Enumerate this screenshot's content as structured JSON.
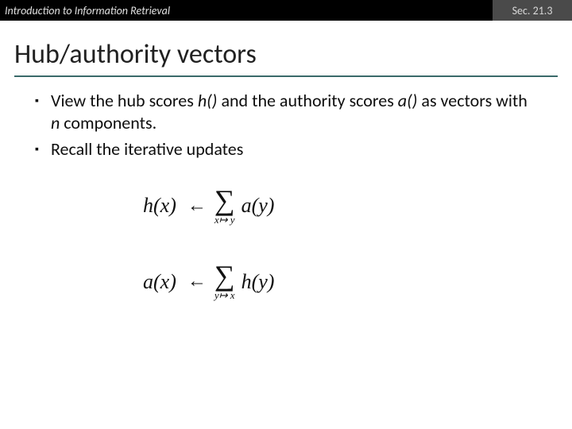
{
  "header": {
    "left": "Introduction to Information Retrieval",
    "right": "Sec. 21.3"
  },
  "title": "Hub/authority vectors",
  "bullets": [
    {
      "pre": "View the hub scores ",
      "i1": "h()",
      "mid1": " and the authority scores ",
      "i2": "a()",
      "mid2": " as vectors with ",
      "i3": "n",
      "post": " components."
    },
    {
      "pre": "Recall the iterative updates",
      "i1": "",
      "mid1": "",
      "i2": "",
      "mid2": "",
      "i3": "",
      "post": ""
    }
  ],
  "equations": [
    {
      "lhs": "h(x)",
      "sub_lhs": "x",
      "sub_rel": "↦",
      "sub_rhs": "y",
      "rhs": "a(y)"
    },
    {
      "lhs": "a(x)",
      "sub_lhs": "y",
      "sub_rel": "↦",
      "sub_rhs": "x",
      "rhs": "h(y)"
    }
  ],
  "glyphs": {
    "bullet": "▪",
    "arrow": "←",
    "sigma": "∑"
  }
}
